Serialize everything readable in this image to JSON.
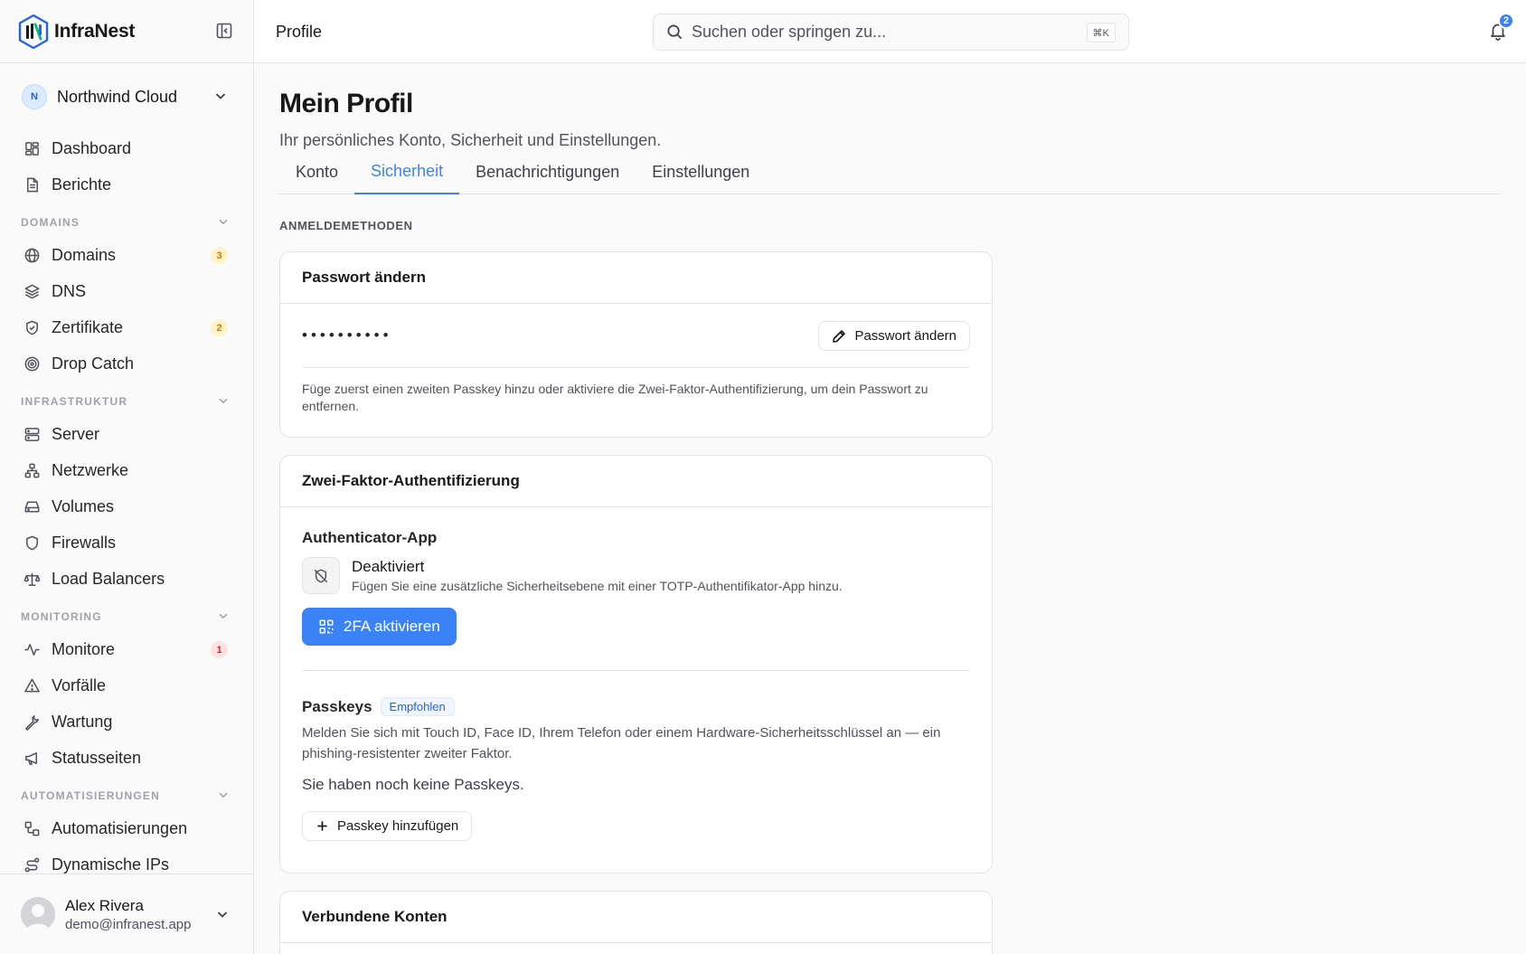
{
  "brand": {
    "name": "InfraNest"
  },
  "workspace": {
    "initial": "N",
    "name": "Northwind Cloud"
  },
  "nav": {
    "top": [
      {
        "label": "Dashboard",
        "icon": "dashboard-icon"
      },
      {
        "label": "Berichte",
        "icon": "file-text-icon"
      }
    ],
    "sections": [
      {
        "title": "DOMAINS",
        "items": [
          {
            "label": "Domains",
            "icon": "globe-icon",
            "badge": "3",
            "badge_color": "#d97706"
          },
          {
            "label": "DNS",
            "icon": "layers-icon"
          },
          {
            "label": "Zertifikate",
            "icon": "shield-check-icon",
            "badge": "2",
            "badge_color": "#d97706"
          },
          {
            "label": "Drop Catch",
            "icon": "target-icon"
          }
        ]
      },
      {
        "title": "INFRASTRUKTUR",
        "items": [
          {
            "label": "Server",
            "icon": "server-icon"
          },
          {
            "label": "Netzwerke",
            "icon": "network-icon"
          },
          {
            "label": "Volumes",
            "icon": "hard-drive-icon"
          },
          {
            "label": "Firewalls",
            "icon": "shield-icon"
          },
          {
            "label": "Load Balancers",
            "icon": "scale-icon"
          }
        ]
      },
      {
        "title": "MONITORING",
        "items": [
          {
            "label": "Monitore",
            "icon": "activity-icon",
            "badge": "1",
            "badge_color": "#dc2626"
          },
          {
            "label": "Vorfälle",
            "icon": "alert-triangle-icon"
          },
          {
            "label": "Wartung",
            "icon": "wrench-icon"
          },
          {
            "label": "Statusseiten",
            "icon": "megaphone-icon"
          }
        ]
      },
      {
        "title": "AUTOMATISIERUNGEN",
        "items": [
          {
            "label": "Automatisierungen",
            "icon": "workflow-icon"
          },
          {
            "label": "Dynamische IPs",
            "icon": "route-icon"
          }
        ]
      }
    ]
  },
  "user": {
    "name": "Alex Rivera",
    "email": "demo@infranest.app"
  },
  "topbar": {
    "crumb": "Profile",
    "search_placeholder": "Suchen oder springen zu...",
    "shortcut": "⌘K",
    "notifications": "2"
  },
  "page": {
    "title": "Mein Profil",
    "subtitle": "Ihr persönliches Konto, Sicherheit und Einstellungen.",
    "tabs": [
      "Konto",
      "Sicherheit",
      "Benachrichtigungen",
      "Einstellungen"
    ],
    "active_tab": "Sicherheit",
    "section_label": "ANMELDEMETHODEN"
  },
  "password_card": {
    "title": "Passwort ändern",
    "masked": "••••••••••",
    "button": "Passwort ändern",
    "note": "Füge zuerst einen zweiten Passkey hinzu oder aktiviere die Zwei-Faktor-Authentifizierung, um dein Passwort zu entfernen."
  },
  "twofa_card": {
    "title": "Zwei-Faktor-Authentifizierung",
    "app_title": "Authenticator-App",
    "status": "Deaktiviert",
    "status_desc": "Fügen Sie eine zusätzliche Sicherheitsebene mit einer TOTP-Authentifikator-App hinzu.",
    "enable_button": "2FA aktivieren",
    "passkeys_title": "Passkeys",
    "passkeys_badge": "Empfohlen",
    "passkeys_desc": "Melden Sie sich mit Touch ID, Face ID, Ihrem Telefon oder einem Hardware-Sicherheitsschlüssel an — ein phishing-resistenter zweiter Faktor.",
    "passkeys_empty": "Sie haben noch keine Passkeys.",
    "add_passkey_button": "Passkey hinzufügen"
  },
  "linked_card": {
    "title": "Verbundene Konten"
  },
  "colors": {
    "accent": "#3b82f6",
    "warning": "#d97706",
    "danger": "#dc2626"
  }
}
